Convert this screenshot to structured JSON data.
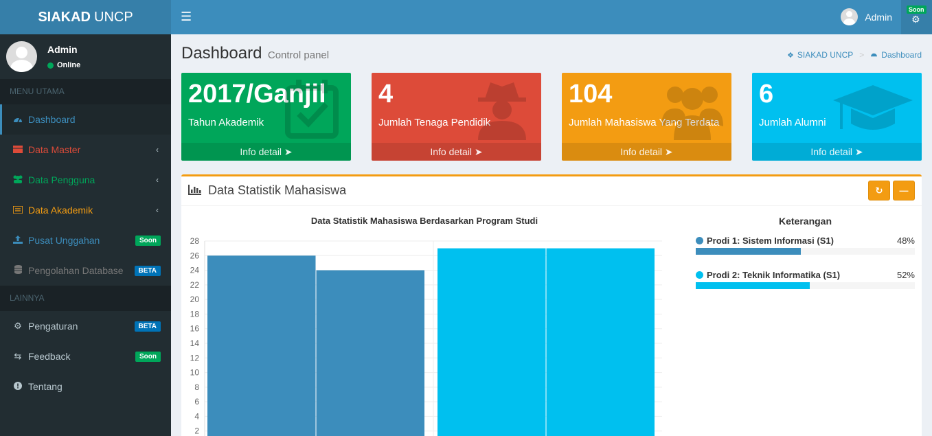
{
  "app": {
    "logo_bold": "SIAKAD",
    "logo_light": "UNCP"
  },
  "navbar": {
    "user_name": "Admin",
    "settings_badge": "Soon"
  },
  "sidebar": {
    "user": {
      "name": "Admin",
      "status": "Online"
    },
    "section_main": "MENU UTAMA",
    "section_other": "LAINNYA",
    "items": [
      {
        "label": "Dashboard",
        "icon": "dashboard-icon",
        "color": "#3c8dbc"
      },
      {
        "label": "Data Master",
        "icon": "table-icon",
        "color": "#dd4b39"
      },
      {
        "label": "Data Pengguna",
        "icon": "users-icon",
        "color": "#00a65a"
      },
      {
        "label": "Data Akademik",
        "icon": "list-icon",
        "color": "#f39c12"
      },
      {
        "label": "Pusat Unggahan",
        "icon": "upload-icon",
        "color": "#3c8dbc",
        "badge": "Soon"
      },
      {
        "label": "Pengolahan Database",
        "icon": "database-icon",
        "color": "#777",
        "badge": "BETA"
      }
    ],
    "other_items": [
      {
        "label": "Pengaturan",
        "icon": "gears-icon",
        "badge": "BETA"
      },
      {
        "label": "Feedback",
        "icon": "retweet-icon",
        "badge": "Soon"
      },
      {
        "label": "Tentang",
        "icon": "info-icon"
      }
    ]
  },
  "header": {
    "title": "Dashboard",
    "subtitle": "Control panel",
    "breadcrumb": [
      "SIAKAD UNCP",
      "Dashboard"
    ]
  },
  "stats": [
    {
      "value": "2017/Ganjil",
      "label": "Tahun Akademik",
      "footer": "Info detail",
      "color": "#00a65a"
    },
    {
      "value": "4",
      "label": "Jumlah Tenaga Pendidik",
      "footer": "Info detail",
      "color": "#dd4b39"
    },
    {
      "value": "104",
      "label": "Jumlah Mahasiswa Yang Terdata",
      "footer": "Info detail",
      "color": "#f39c12"
    },
    {
      "value": "6",
      "label": "Jumlah Alumni",
      "footer": "Info detail",
      "color": "#00c0ef"
    }
  ],
  "chart_box": {
    "title": "Data Statistik Mahasiswa",
    "legend_title": "Keterangan"
  },
  "progress": [
    {
      "label": "Prodi 1: Sistem Informasi (S1)",
      "percent_text": "48%",
      "percent": 48,
      "color": "#3c8dbc"
    },
    {
      "label": "Prodi 2: Teknik Informatika (S1)",
      "percent_text": "52%",
      "percent": 52,
      "color": "#00c0ef"
    }
  ],
  "chart_data": {
    "type": "bar",
    "title": "Data Statistik Mahasiswa Berdasarkan Program Studi",
    "categories": [
      "",
      ""
    ],
    "series": [
      {
        "color": "#3c8dbc",
        "values": [
          26,
          24
        ]
      },
      {
        "color": "#00c0ef",
        "values": [
          27,
          27
        ]
      }
    ],
    "ylim": [
      0,
      28
    ],
    "yticks": [
      2,
      4,
      6,
      8,
      10,
      12,
      14,
      16,
      18,
      20,
      22,
      24,
      26,
      28
    ],
    "grid": true
  }
}
